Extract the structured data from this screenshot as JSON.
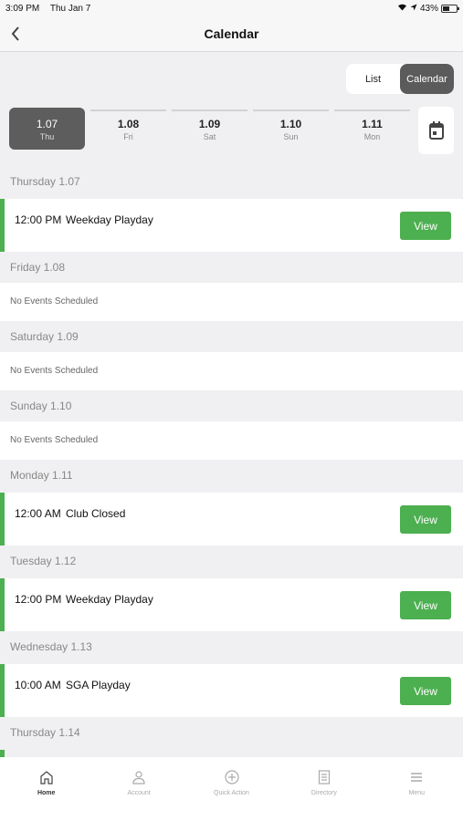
{
  "status_bar": {
    "time": "3:09 PM",
    "date": "Thu Jan 7",
    "battery": "43%"
  },
  "nav": {
    "title": "Calendar"
  },
  "view_toggle": {
    "list": "List",
    "calendar": "Calendar"
  },
  "dates": [
    {
      "num": "1.07",
      "dow": "Thu"
    },
    {
      "num": "1.08",
      "dow": "Fri"
    },
    {
      "num": "1.09",
      "dow": "Sat"
    },
    {
      "num": "1.10",
      "dow": "Sun"
    },
    {
      "num": "1.11",
      "dow": "Mon"
    }
  ],
  "days": [
    {
      "header": "Thursday 1.07",
      "event": {
        "time": "12:00 PM",
        "name": "Weekday Playday",
        "action": "View"
      }
    },
    {
      "header": "Friday 1.08",
      "empty": "No Events Scheduled"
    },
    {
      "header": "Saturday 1.09",
      "empty": "No Events Scheduled"
    },
    {
      "header": "Sunday 1.10",
      "empty": "No Events Scheduled"
    },
    {
      "header": "Monday 1.11",
      "event": {
        "time": "12:00 AM",
        "name": "Club Closed",
        "action": "View"
      }
    },
    {
      "header": "Tuesday 1.12",
      "event": {
        "time": "12:00 PM",
        "name": "Weekday Playday",
        "action": "View"
      }
    },
    {
      "header": "Wednesday 1.13",
      "event": {
        "time": "10:00 AM",
        "name": "SGA Playday",
        "action": "View"
      }
    },
    {
      "header": "Thursday 1.14"
    }
  ],
  "tabs": [
    {
      "label": "Home",
      "icon": "home-icon"
    },
    {
      "label": "Account",
      "icon": "person-icon"
    },
    {
      "label": "Quick Action",
      "icon": "plus-circle-icon"
    },
    {
      "label": "Directory",
      "icon": "directory-icon"
    },
    {
      "label": "Menu",
      "icon": "menu-icon"
    }
  ],
  "colors": {
    "accent": "#4caf50",
    "selected": "#5d5d5d"
  }
}
